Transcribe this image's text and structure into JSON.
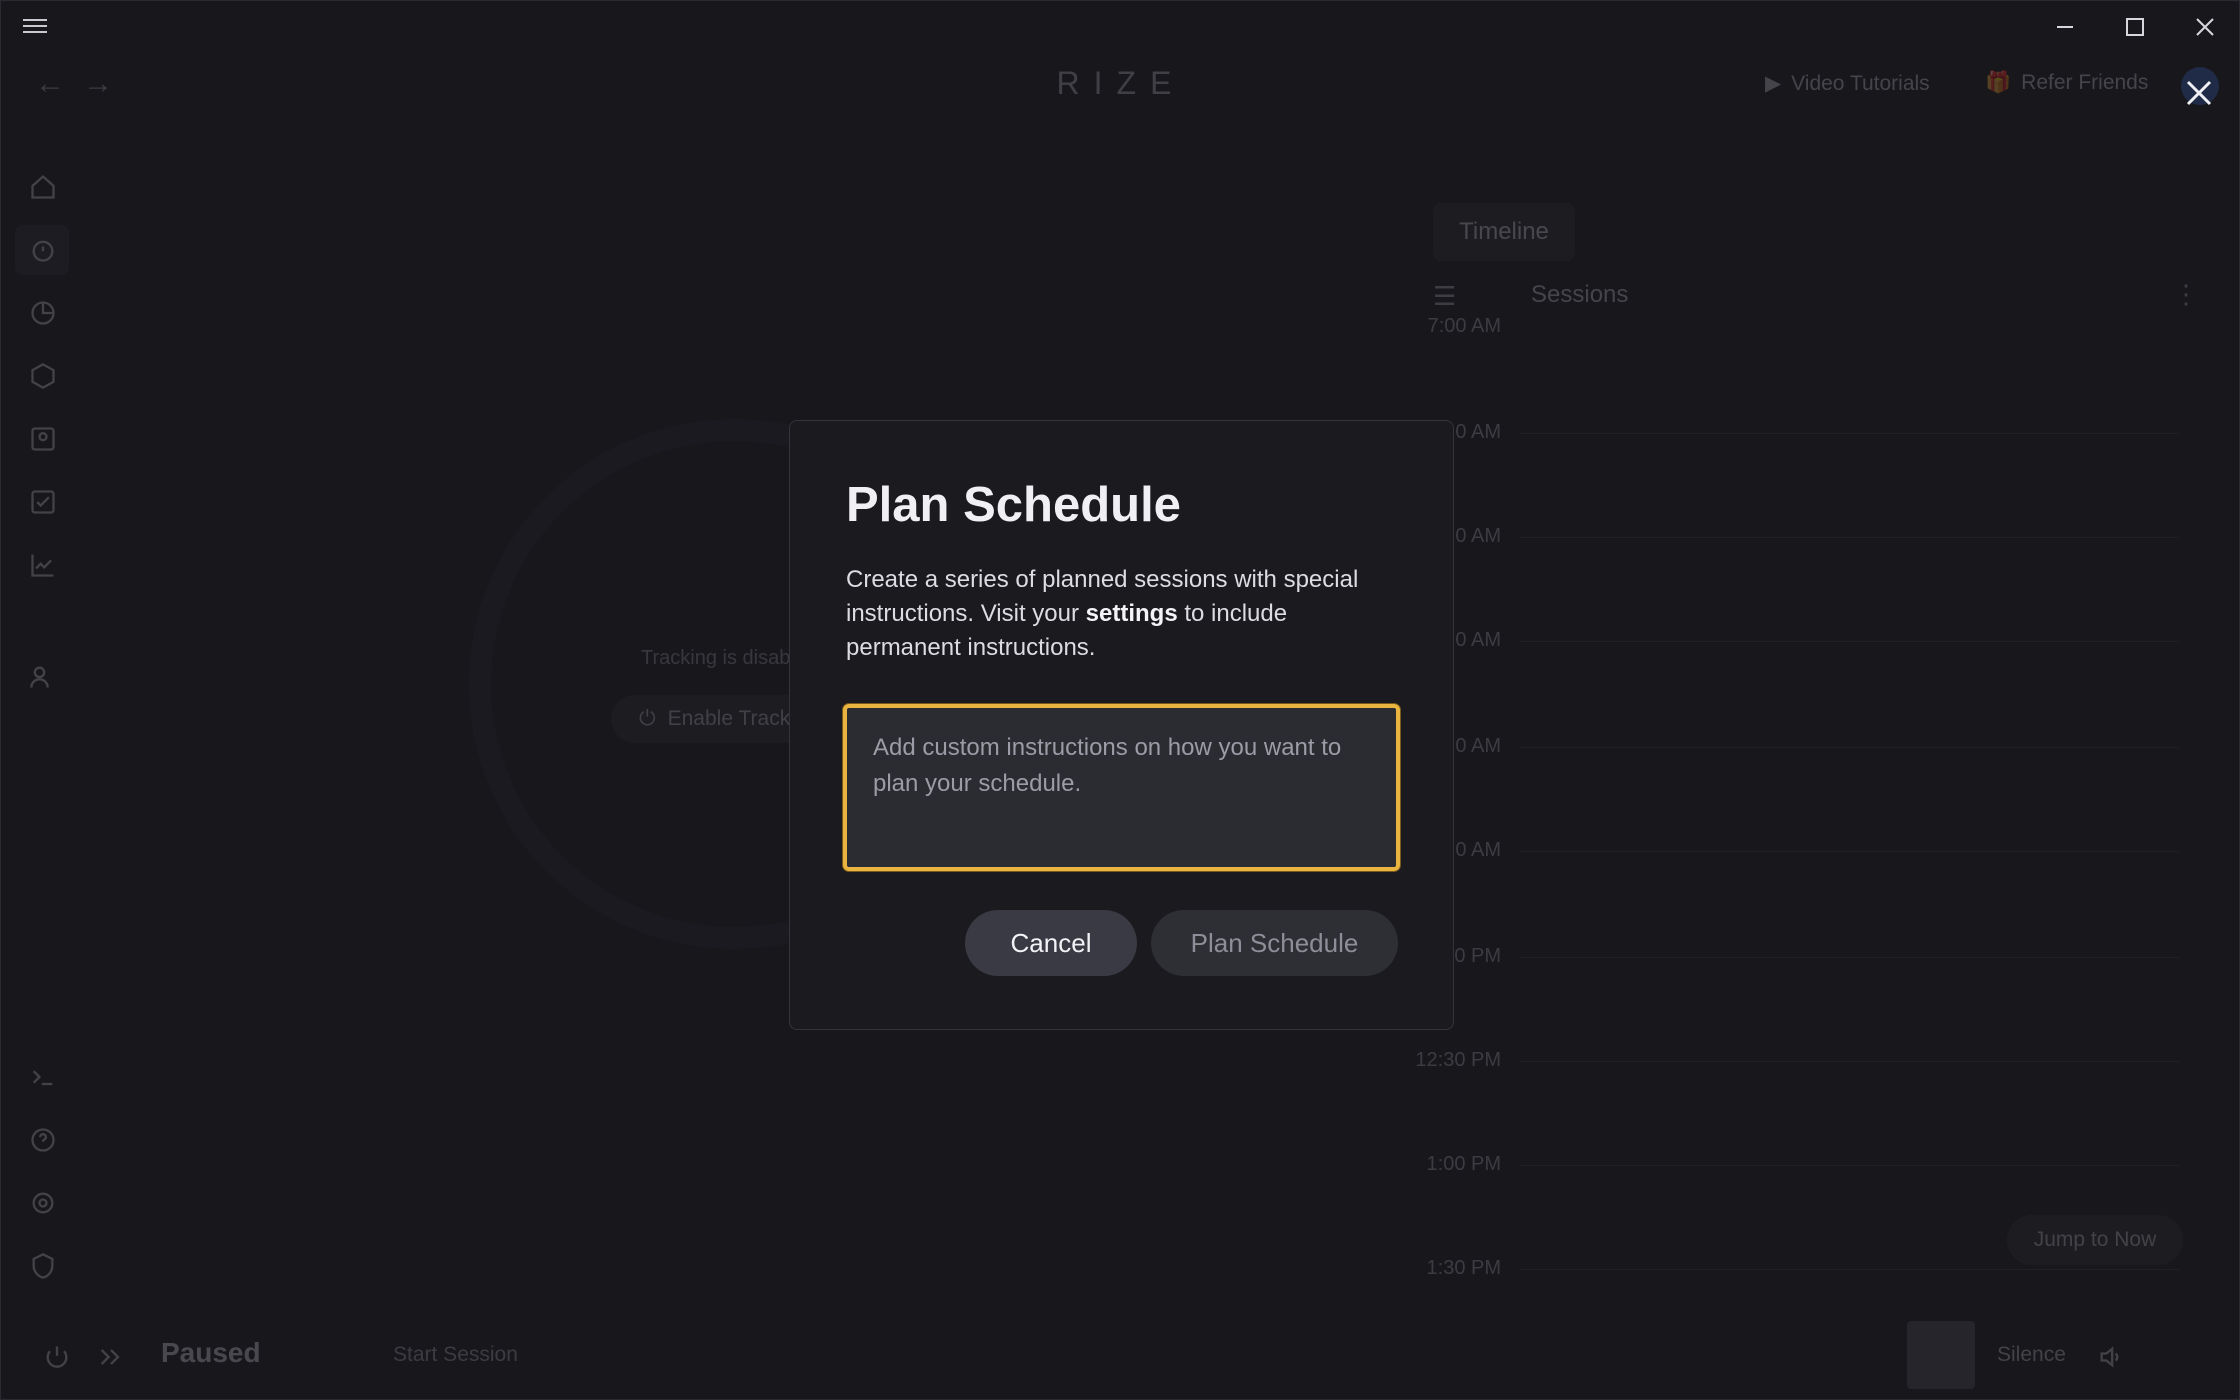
{
  "app": {
    "brand": "RIZE",
    "top_links": {
      "video_tutorials": "Video Tutorials",
      "refer_friends": "Refer Friends"
    }
  },
  "main": {
    "tracking_text": "Tracking is disab",
    "enable_button": "Enable Track"
  },
  "timeline": {
    "tab_label": "Timeline",
    "sessions_label": "Sessions",
    "times": [
      "7:00 AM",
      "0 AM",
      "0 AM",
      "0 AM",
      "0 AM",
      "0 AM",
      "0 PM",
      "12:30 PM",
      "1:00 PM",
      "1:30 PM"
    ],
    "jump_to_now": "Jump to Now"
  },
  "bottom_bar": {
    "status": "Paused",
    "start_session": "Start Session",
    "music_label": "Silence"
  },
  "modal": {
    "title": "Plan Schedule",
    "description_part1": "Create a series of planned sessions with special instructions. Visit your ",
    "description_link": "settings",
    "description_part2": " to include permanent instructions.",
    "input_placeholder": "Add custom instructions on how you want to plan your schedule.",
    "input_value": "",
    "cancel_label": "Cancel",
    "submit_label": "Plan Schedule"
  },
  "colors": {
    "focus_border": "#e9b43f",
    "background": "#17171c",
    "modal_bg": "#1a1a1f"
  }
}
